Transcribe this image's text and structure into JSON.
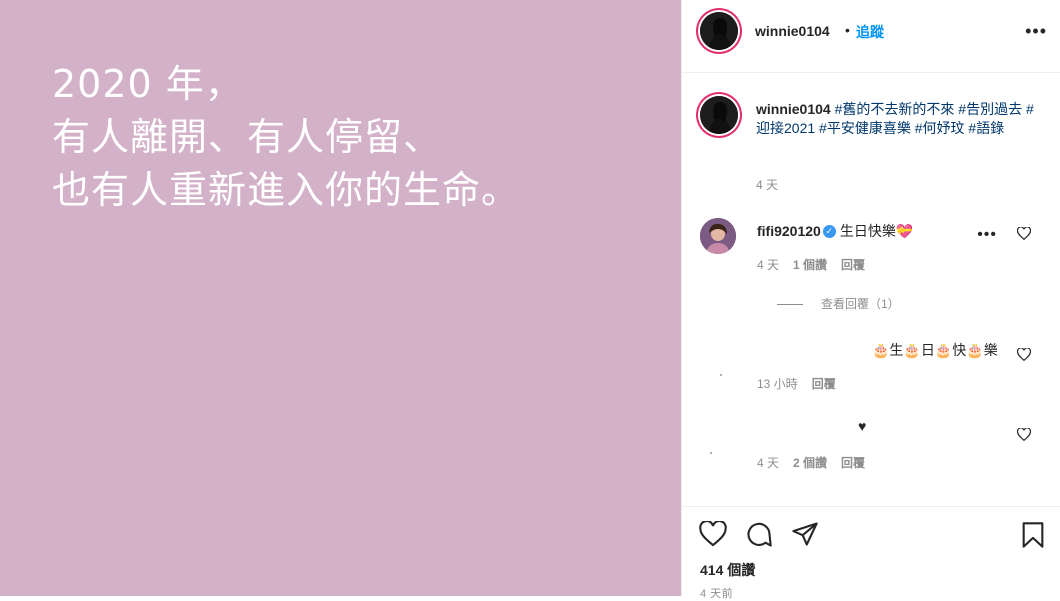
{
  "image": {
    "background": "#d3b1c8",
    "lines": [
      "2020 年，",
      "有人離開、有人停留、",
      "也有人重新進入你的生命。"
    ]
  },
  "header": {
    "username": "winnie0104",
    "separator": "•",
    "follow_label": "追蹤",
    "more_icon": "•••"
  },
  "caption": {
    "username": "winnie0104",
    "hashtags": [
      "#舊的不去新的不來",
      "#告別過去",
      "#迎接2021",
      "#平安健康喜樂",
      "#何妤玟",
      "#語錄"
    ],
    "time": "4 天"
  },
  "comments": [
    {
      "username": "fifi920120",
      "verified": true,
      "text": "生日快樂💝",
      "time": "4 天",
      "likes": "1 個讚",
      "reply_label": "回覆",
      "view_replies": "查看回覆（1）"
    },
    {
      "text": "🎂生🎂日🎂快🎂樂",
      "time": "13 小時",
      "reply_label": "回覆"
    },
    {
      "text": "♥",
      "time": "4 天",
      "likes": "2 個讚",
      "reply_label": "回覆"
    }
  ],
  "actions": {
    "likes": "414 個讚",
    "time": "4 天前"
  }
}
